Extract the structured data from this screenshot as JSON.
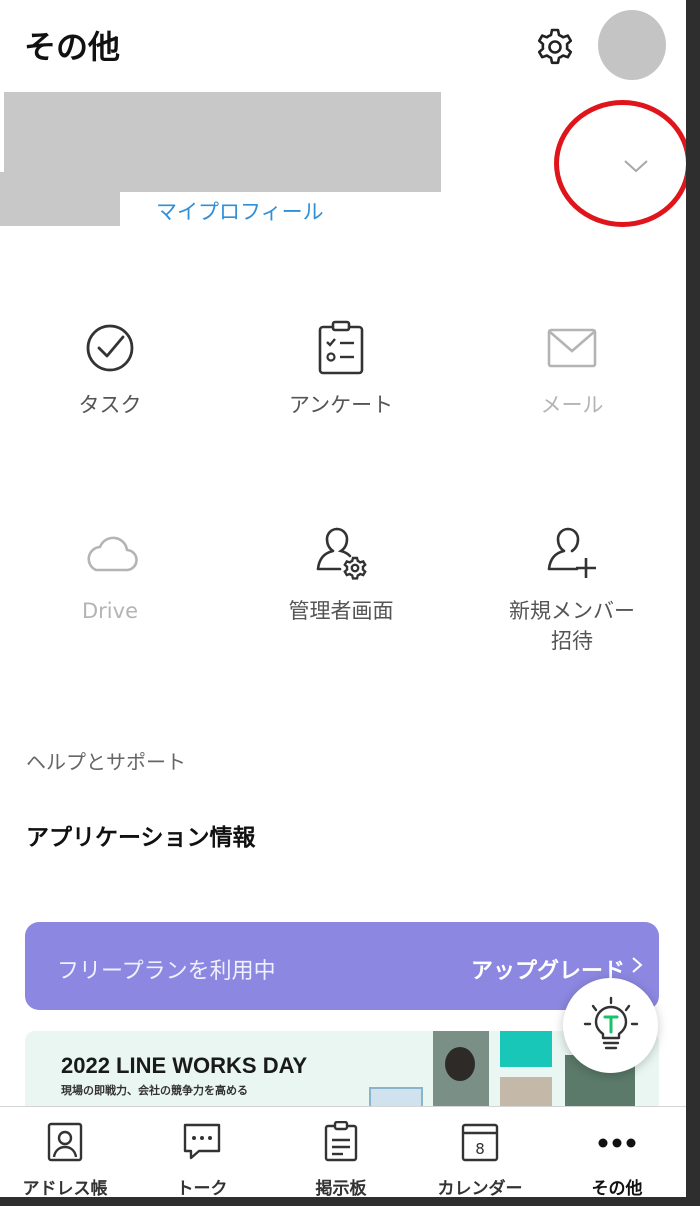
{
  "header": {
    "title": "その他"
  },
  "profile": {
    "link_label": "マイプロフィール"
  },
  "apps": [
    {
      "label": "タスク",
      "icon": "task-check-icon",
      "enabled": true
    },
    {
      "label": "アンケート",
      "icon": "survey-clipboard-icon",
      "enabled": true
    },
    {
      "label": "メール",
      "icon": "mail-envelope-icon",
      "enabled": false
    },
    {
      "label": "Drive",
      "icon": "cloud-icon",
      "enabled": false
    },
    {
      "label": "管理者画面",
      "icon": "admin-user-gear-icon",
      "enabled": true
    },
    {
      "label": "新規メンバー\n招待",
      "icon": "invite-user-plus-icon",
      "enabled": true
    }
  ],
  "sections": {
    "help": "ヘルプとサポート",
    "app_info": "アプリケーション情報"
  },
  "plan_banner": {
    "status": "フリープランを利用中",
    "upgrade_label": "アップグレード",
    "color": "#8c87e0"
  },
  "promo": {
    "title": "2022 LINE WORKS DAY",
    "subtitle": "現場の即戦力、会社の競争力を高める"
  },
  "tabbar": {
    "items": [
      {
        "label": "アドレス帳",
        "icon": "address-book-icon"
      },
      {
        "label": "トーク",
        "icon": "chat-bubble-icon"
      },
      {
        "label": "掲示板",
        "icon": "board-clipboard-icon"
      },
      {
        "label": "カレンダー",
        "icon": "calendar-icon",
        "day": "8"
      },
      {
        "label": "その他",
        "icon": "more-dots-icon",
        "active": true
      }
    ]
  },
  "colors": {
    "accent_link": "#2f8fd8",
    "highlight_circle": "#e0151b",
    "tips_green": "#17c36a"
  }
}
